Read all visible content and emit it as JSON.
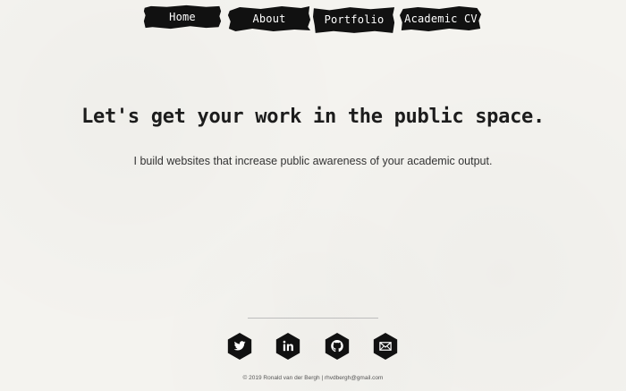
{
  "nav": {
    "items": [
      {
        "label": "Home"
      },
      {
        "label": "About"
      },
      {
        "label": "Portfolio"
      },
      {
        "label": "Academic CV"
      }
    ]
  },
  "hero": {
    "headline": "Let's get your work in the public space.",
    "subline": "I build websites that increase public awareness of your academic output."
  },
  "social": {
    "icons": [
      "twitter-icon",
      "linkedin-icon",
      "github-icon",
      "email-icon"
    ]
  },
  "footer": {
    "copyright": "© 2019 Ronald van der Bergh",
    "separator": " | ",
    "email": "rhvdbergh@gmail.com"
  },
  "colors": {
    "background": "#f4f3ef",
    "brush": "#111111",
    "hexagon": "#111111",
    "divider": "#bdbdbd"
  }
}
